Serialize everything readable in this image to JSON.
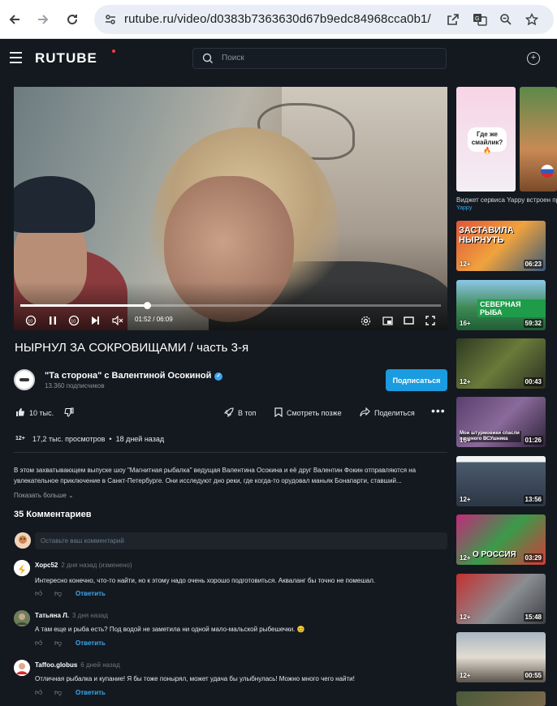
{
  "browser": {
    "url": "rutube.ru/video/d0383b7363630d67b9edc84968cca0b1/",
    "back_icon": "arrow-left-icon",
    "forward_icon": "arrow-right-icon",
    "reload_icon": "reload-icon"
  },
  "header": {
    "logo": "RUTUBE",
    "search_placeholder": "Поиск"
  },
  "player": {
    "time": "01:52 / 06:09",
    "progress": 0.303,
    "rewind_label": "10",
    "forward_label": "10"
  },
  "video": {
    "title": "НЫРНУЛ ЗА СОКРОВИЩАМИ / часть 3-я",
    "channel_name": "\"Та сторона\" с Валентиной Осокиной",
    "channel_subs": "13.360 подписчиков",
    "subscribe_label": "Подписаться",
    "likes": "10 тыс.",
    "top_label": "В топ",
    "watch_later_label": "Смотреть позже",
    "share_label": "Поделиться",
    "age": "12+",
    "views": "17,2 тыс. просмотров",
    "published": "18 дней назад",
    "description": "В этом захватывающем выпуске шоу \"Магнитная рыбалка\" ведущая Валентина Осокина и её друг Валентин Фокин отправляются на увлекательное приключение в Санкт-Петербурге. Они исследуют дно реки, где когда-то орудовал маньяк Бонапарти, ставший...",
    "show_more": "Показать больше"
  },
  "comments": {
    "heading": "35 Комментариев",
    "placeholder": "Оставьте ваш комментарий",
    "reply_label": "Ответить",
    "items": [
      {
        "author": "Хорс52",
        "date": "2 дня назад (изменено)",
        "text": "Интересно конечно, что-то найти, но к этому надо очень хорошо подготовиться. Акваланг бы точно не помешал."
      },
      {
        "author": "Татьяна Л.",
        "date": "3 дня назад",
        "text": "А там еще и рыба есть? Под водой не заметила ни одной мало-мальской рыбешечки. 😊"
      },
      {
        "author": "Taffoo.globus",
        "date": "6 дней назад",
        "text": "Отличная рыбалка и купание! Я бы тоже понырял, может удача бы улыбнулась! Можно много чего найти!"
      }
    ]
  },
  "sidebar": {
    "shorts_caption": "Виджет сервиса Yappy встроен пра",
    "shorts_source": "Yappy",
    "short_bubble": "Где же смайлик? 🔥",
    "recs": [
      {
        "age": "12+",
        "duration": "06:23",
        "thumb_text": "ЗАСТАВИЛА НЫРНУТЬ"
      },
      {
        "age": "16+",
        "duration": "59:32",
        "thumb_text": "СЕВЕРНАЯ РЫБА"
      },
      {
        "age": "12+",
        "duration": "00:43",
        "thumb_text": ""
      },
      {
        "age": "16+",
        "duration": "01:26",
        "thumb_text": "Мои штурмовики спасли раненого ВСУшника"
      },
      {
        "age": "12+",
        "duration": "13:56",
        "thumb_text": ""
      },
      {
        "age": "12+",
        "duration": "03:29",
        "thumb_text": "О РОССИЯ"
      },
      {
        "age": "12+",
        "duration": "15:48",
        "thumb_text": ""
      },
      {
        "age": "12+",
        "duration": "00:55",
        "thumb_text": ""
      }
    ]
  }
}
